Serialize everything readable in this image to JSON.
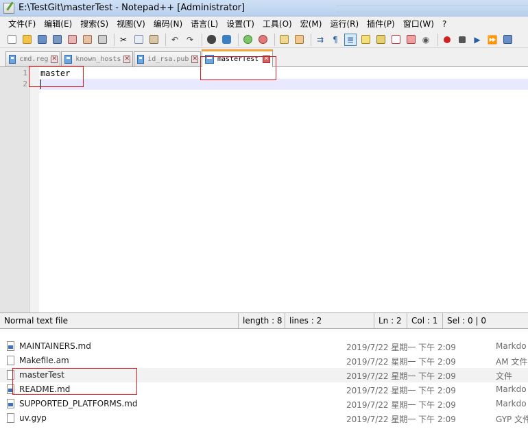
{
  "window": {
    "title": "E:\\TestGit\\masterTest - Notepad++ [Administrator]"
  },
  "menu": [
    "文件(F)",
    "编辑(E)",
    "搜索(S)",
    "视图(V)",
    "编码(N)",
    "语言(L)",
    "设置(T)",
    "工具(O)",
    "宏(M)",
    "运行(R)",
    "插件(P)",
    "窗口(W)",
    "?"
  ],
  "tabs": [
    {
      "label": "cmd.reg",
      "active": false
    },
    {
      "label": "known_hosts",
      "active": false
    },
    {
      "label": "id_rsa.pub",
      "active": false
    },
    {
      "label": "masterTest",
      "active": true
    }
  ],
  "editor": {
    "lines": [
      {
        "num": "1",
        "text": "master"
      },
      {
        "num": "2",
        "text": ""
      }
    ],
    "current_line": 2
  },
  "status": {
    "file_type": "Normal text file",
    "length": "length : 8",
    "lines": "lines : 2",
    "ln": "Ln : 2",
    "col": "Col : 1",
    "sel": "Sel : 0 | 0"
  },
  "explorer": {
    "files": [
      {
        "name": "MAINTAINERS.md",
        "date": "2019/7/22 星期一 下午 2:09",
        "type": "Markdo",
        "icon": "markdown-file-icon"
      },
      {
        "name": "Makefile.am",
        "date": "2019/7/22 星期一 下午 2:09",
        "type": "AM 文件",
        "icon": "file-icon"
      },
      {
        "name": "masterTest",
        "date": "2019/7/22 星期一 下午 2:09",
        "type": "文件",
        "icon": "file-icon",
        "selected": true
      },
      {
        "name": "README.md",
        "date": "2019/7/22 星期一 下午 2:09",
        "type": "Markdo",
        "icon": "markdown-file-icon"
      },
      {
        "name": "SUPPORTED_PLATFORMS.md",
        "date": "2019/7/22 星期一 下午 2:09",
        "type": "Markdo",
        "icon": "markdown-file-icon"
      },
      {
        "name": "uv.gyp",
        "date": "2019/7/22 星期一 下午 2:09",
        "type": "GYP 文件",
        "icon": "file-icon"
      }
    ]
  },
  "colors": {
    "annotation": "#d81e1e",
    "active_tab_accent": "#f3a23c",
    "current_line": "#e8e8ff"
  }
}
